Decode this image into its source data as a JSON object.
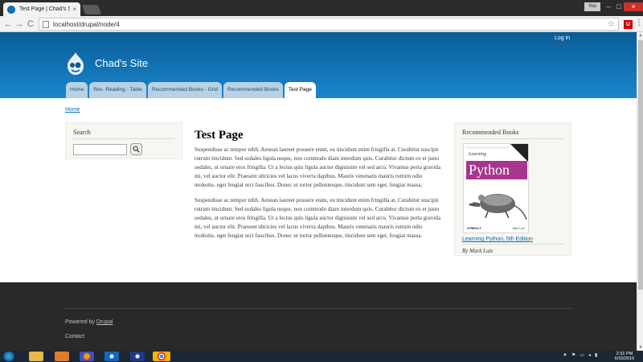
{
  "browser": {
    "tab_title": "Test Page | Chad's Site",
    "tab_close": "×",
    "user_label": "You",
    "url": "localhost/drupal/node/4",
    "back": "←",
    "forward": "→",
    "reload": "C",
    "star": "☆",
    "ext_label": "U",
    "menu": "⋮",
    "win_min": "–",
    "win_max": "□",
    "win_close": "×"
  },
  "header": {
    "login": "Log in",
    "site_name": "Chad's Site",
    "nav": [
      {
        "label": "Home"
      },
      {
        "label": "Rec. Reading - Table"
      },
      {
        "label": "Recommended Books - Grid"
      },
      {
        "label": "Recommended Books"
      },
      {
        "label": "Test Page",
        "active": true
      }
    ]
  },
  "breadcrumb": "Home",
  "sidebar_first": {
    "title": "Search",
    "search_placeholder": ""
  },
  "main": {
    "title": "Test Page",
    "paragraphs": [
      "Suspendisse ac tempor nibh. Aenean laoreet posuere enim, eu tincidunt enim fringilla at. Curabitur suscipit rutrum tincidunt. Sed sodales ligula neque, non commodo diam interdum quis. Curabitur dictum ex et justo sodales, ut ornare eros fringilla. Ut a lectus quis ligula auctor dignissim vel sed arcu. Vivamus porta gravida mi, vel auctor elit. Praesent ultricies vel lacus viverra dapibus. Mauris venenatis mauris rutrum odio molestie, eget feugiat orci faucibus. Donec ut tortor pellentesque, tincidunt sem eget, feugiat massa.",
      "Suspendisse ac tempor nibh. Aenean laoreet posuere enim, eu tincidunt enim fringilla at. Curabitur suscipit rutrum tincidunt. Sed sodales ligula neque, non commodo diam interdum quis. Curabitur dictum ex et justo sodales, ut ornare eros fringilla. Ut a lectus quis ligula auctor dignissim vel sed arcu. Vivamus porta gravida mi, vel auctor elit. Praesent ultricies vel lacus viverra dapibus. Mauris venenatis mauris rutrum odio molestie, eget feugiat orci faucibus. Donec ut tortor pellentesque, tincidunt sem eget, feugiat massa."
    ]
  },
  "sidebar_second": {
    "title": "Recommended Books",
    "book": {
      "cover_learning": "Learning",
      "cover_title": "Python",
      "cover_publisher": "O'REILLY",
      "cover_author": "Mark Lutz",
      "link": "Learning Python, 5th Edition",
      "author": "By Mark Lutz"
    }
  },
  "footer": {
    "powered_prefix": "Powered by ",
    "powered_link": "Drupal",
    "contact": "Contact"
  },
  "taskbar": {
    "time": "2:31 PM",
    "date": "6/10/2016"
  },
  "colors": {
    "header_top": "#0a5c97",
    "header_bottom": "#1a86cc",
    "link": "#0071b3",
    "footer_bg": "#292929",
    "book_band": "#a8358f"
  }
}
